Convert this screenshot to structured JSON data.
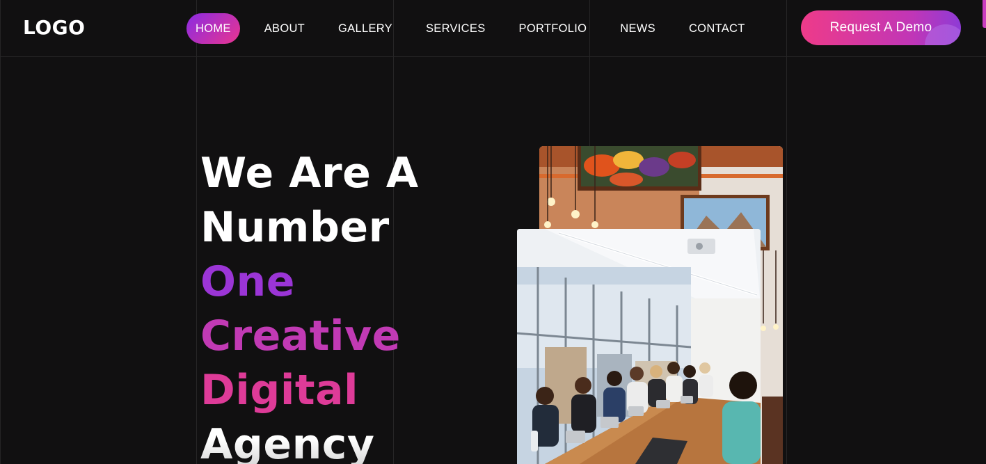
{
  "header": {
    "logo": "LOGO",
    "nav": [
      {
        "label": "HOME",
        "active": true
      },
      {
        "label": "ABOUT",
        "active": false
      },
      {
        "label": "GALLERY",
        "active": false
      },
      {
        "label": "SERVICES",
        "active": false
      },
      {
        "label": "PORTFOLIO",
        "active": false
      },
      {
        "label": "NEWS",
        "active": false
      },
      {
        "label": "CONTACT",
        "active": false
      }
    ],
    "cta_label": "Request A Demo"
  },
  "hero": {
    "line1": "We Are A",
    "line2": "Number",
    "line3": "One",
    "line4": "Creative",
    "line5": "Digital",
    "line6": "Agency"
  },
  "colors": {
    "background": "#111011",
    "accent_purple": "#8a2be2",
    "accent_pink": "#e9358f",
    "grid_line": "#262526",
    "text": "#ffffff"
  },
  "images": {
    "back_photo": "restaurant-interior-photo",
    "front_photo": "team-meeting-photo"
  }
}
